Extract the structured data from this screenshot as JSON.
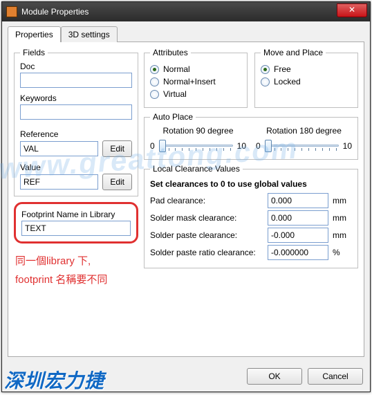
{
  "window": {
    "title": "Module Properties"
  },
  "tabs": {
    "properties": "Properties",
    "threeD": "3D settings"
  },
  "fields": {
    "legend": "Fields",
    "doc_label": "Doc",
    "doc_value": "",
    "keywords_label": "Keywords",
    "keywords_value": "",
    "reference_label": "Reference",
    "reference_value": "VAL",
    "edit": "Edit",
    "value_label": "Value",
    "value_value": "REF"
  },
  "fp": {
    "label": "Footprint Name in Library",
    "value": "TEXT"
  },
  "annot": {
    "line1": "同一個library 下,",
    "line2": "footprint 名稱要不同"
  },
  "attributes": {
    "legend": "Attributes",
    "normal": "Normal",
    "normal_insert": "Normal+Insert",
    "virtual": "Virtual"
  },
  "move": {
    "legend": "Move and Place",
    "free": "Free",
    "locked": "Locked"
  },
  "autoplace": {
    "legend": "Auto Place",
    "rot90": "Rotation 90 degree",
    "rot180": "Rotation 180 degree",
    "min": "0",
    "max": "10"
  },
  "clearance": {
    "legend": "Local Clearance Values",
    "hint": "Set clearances to 0 to use global values",
    "pad_label": "Pad clearance:",
    "pad_value": "0.000",
    "solder_mask_label": "Solder mask clearance:",
    "solder_mask_value": "0.000",
    "solder_paste_label": "Solder paste clearance:",
    "solder_paste_value": "-0.000",
    "solder_paste_ratio_label": "Solder paste ratio clearance:",
    "solder_paste_ratio_value": "-0.000000",
    "mm": "mm",
    "pct": "%"
  },
  "footer": {
    "ok": "OK",
    "cancel": "Cancel"
  },
  "watermark": "www.greattong.com",
  "brand": "深圳宏力捷"
}
